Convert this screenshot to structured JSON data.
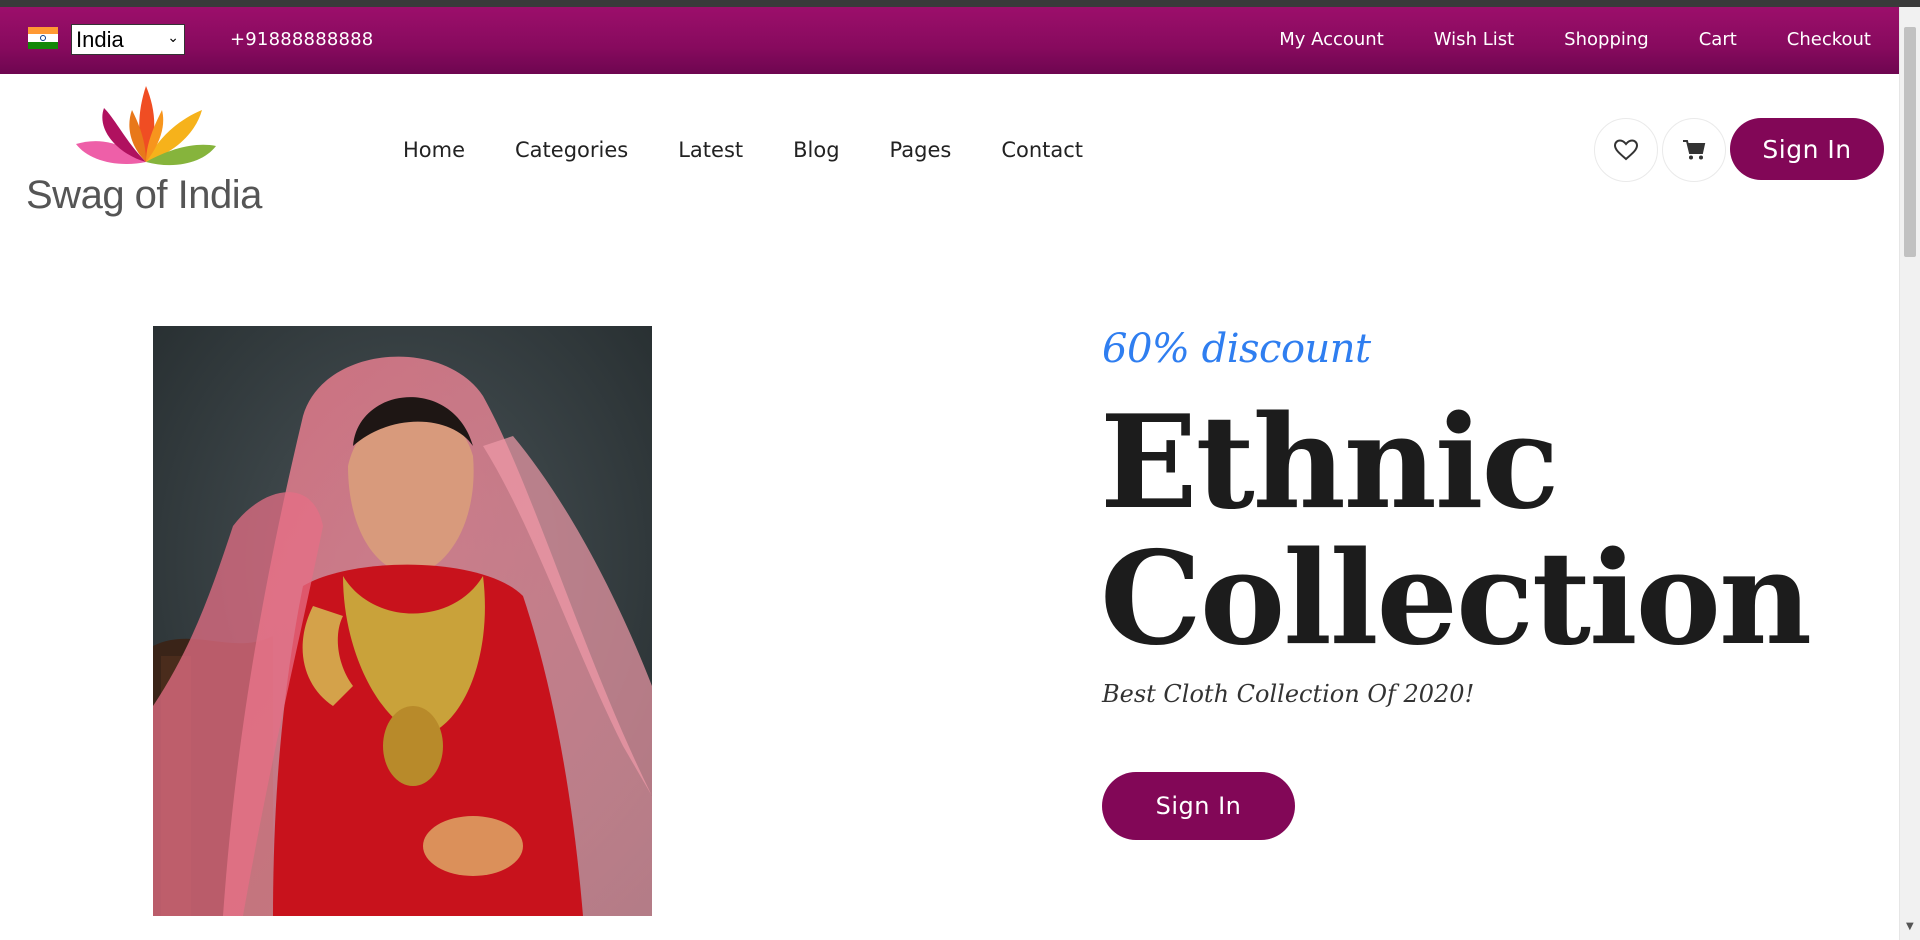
{
  "topbar": {
    "country_flag_icon": "india-flag-icon",
    "country_selected": "India",
    "phone": "+91888888888",
    "links": [
      "My Account",
      "Wish List",
      "Shopping",
      "Cart",
      "Checkout"
    ]
  },
  "header": {
    "logo_text": "Swag of India",
    "nav": [
      "Home",
      "Categories",
      "Latest",
      "Blog",
      "Pages",
      "Contact"
    ],
    "icons": [
      "heart-icon",
      "cart-icon"
    ],
    "signin_label": "Sign In"
  },
  "hero": {
    "discount": "60% discount",
    "title_line1": "Ethnic",
    "title_line2": "Collection",
    "subtitle": "Best Cloth Collection Of 2020!",
    "cta_label": "Sign In",
    "image": "bride-in-red-lehenga-photo"
  },
  "colors": {
    "topbar": "#870a5e",
    "button": "#820757",
    "discount": "#2f7ef0",
    "title": "#1c1c1c"
  }
}
